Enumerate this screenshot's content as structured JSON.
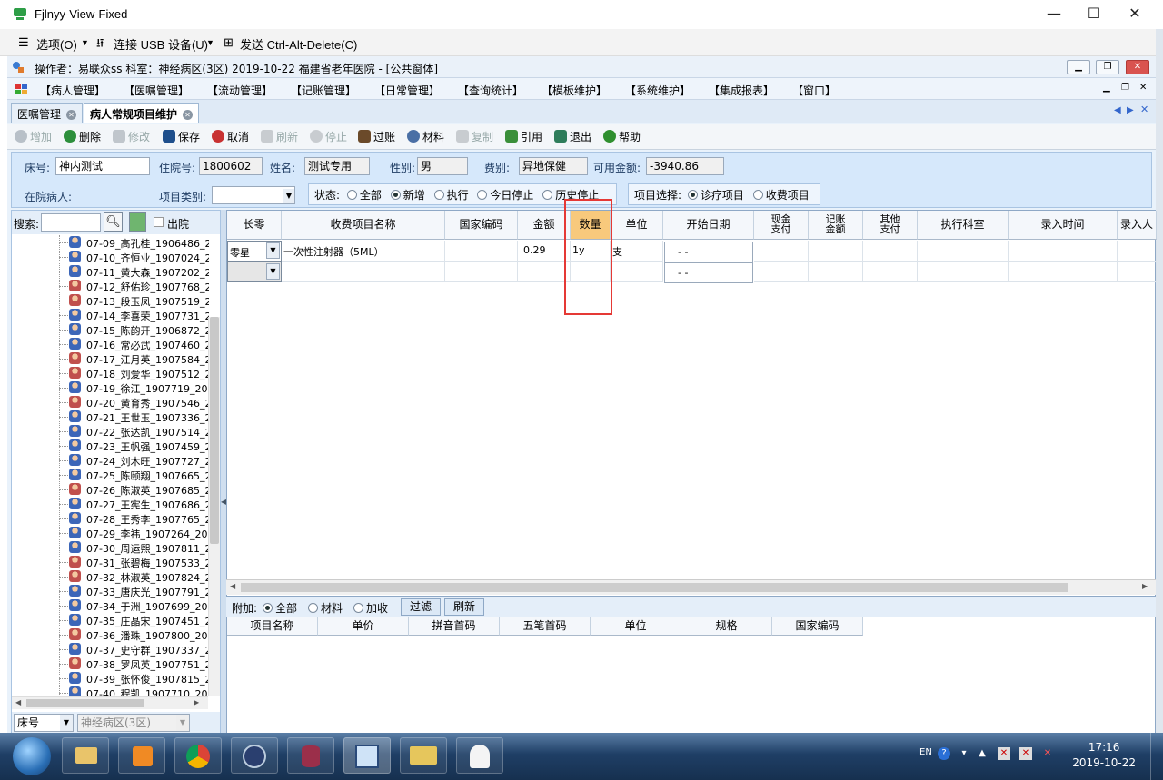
{
  "window": {
    "title": "Fjlnyy-View-Fixed",
    "minimize": "—",
    "maximize": "☐",
    "close": "✕"
  },
  "vm_toolbar": {
    "options": "选项(O)",
    "usb": "连接 USB 设备(U)",
    "send": "发送 Ctrl-Alt-Delete(C)"
  },
  "app": {
    "title": "操作者：易联众ss   科室：神经病区(3区)   2019-10-22   福建省老年医院 - [公共窗体]",
    "menu": [
      "【病人管理】",
      "【医嘱管理】",
      "【流动管理】",
      "【记账管理】",
      "【日常管理】",
      "【查询统计】",
      "【模板维护】",
      "【系统维护】",
      "【集成报表】",
      "【窗口】"
    ],
    "tabs": [
      "医嘱管理",
      "病人常规项目维护"
    ],
    "toolbar": {
      "add": "增加",
      "delete": "删除",
      "modify": "修改",
      "save": "保存",
      "cancel": "取消",
      "refresh": "刷新",
      "stop": "停止",
      "post": "过账",
      "material": "材料",
      "copy": "复制",
      "quote": "引用",
      "exit": "退出",
      "help": "帮助"
    }
  },
  "form": {
    "bed_label": "床号:",
    "bed_value": "神内测试",
    "admission_label": "住院号:",
    "admission_value": "1800602",
    "name_label": "姓名:",
    "name_value": "测试专用",
    "gender_label": "性别:",
    "gender_value": "男",
    "fee_type_label": "费别:",
    "fee_type_value": "异地保健",
    "balance_label": "可用金额:",
    "balance_value": "-3940.86",
    "inpatient_label": "在院病人:",
    "category_label": "项目类别:",
    "category_value": "",
    "status_label": "状态:",
    "status_options": [
      "全部",
      "新增",
      "执行",
      "今日停止",
      "历史停止"
    ],
    "status_selected": "新增",
    "selection_label": "项目选择:",
    "selection_options": [
      "诊疗项目",
      "收费项目"
    ],
    "selection_selected": "诊疗项目"
  },
  "left": {
    "search_label": "搜索:",
    "discharged_label": "出院",
    "patients": [
      "07-09_高孔桂_1906486_2",
      "07-10_齐恒业_1907024_2",
      "07-11_黄大森_1907202_2",
      "07-12_舒佑珍_1907768_2",
      "07-13_段玉凤_1907519_2",
      "07-14_李喜荣_1907731_2",
      "07-15_陈韵开_1906872_2",
      "07-16_常必武_1907460_2",
      "07-17_江月英_1907584_2",
      "07-18_刘爱华_1907512_2",
      "07-19_徐江_1907719_201",
      "07-20_黄育秀_1907546_2",
      "07-21_王世玉_1907336_2",
      "07-22_张达凯_1907514_2",
      "07-23_王帆强_1907459_2",
      "07-24_刘木旺_1907727_2",
      "07-25_陈颐翔_1907665_2",
      "07-26_陈淑英_1907685_2",
      "07-27_王宪生_1907686_2",
      "07-28_王秀李_1907765_2",
      "07-29_李祎_1907264_201",
      "07-30_周运熙_1907811_2",
      "07-31_张碧梅_1907533_2",
      "07-32_林淑英_1907824_2",
      "07-33_唐庆光_1907791_2",
      "07-34_于洲_1907699_201",
      "07-35_庄晶宋_1907451_2",
      "07-36_潘珠_1907800_201",
      "07-37_史守群_1907337_2",
      "07-38_罗凤英_1907751_2",
      "07-39_张怀俊_1907815_2",
      "07-40_程凯_1907710_201"
    ],
    "patient_gender": [
      "m",
      "m",
      "m",
      "f",
      "f",
      "m",
      "m",
      "m",
      "f",
      "f",
      "m",
      "f",
      "m",
      "m",
      "m",
      "m",
      "m",
      "f",
      "m",
      "m",
      "m",
      "m",
      "f",
      "f",
      "m",
      "m",
      "m",
      "f",
      "m",
      "f",
      "m",
      "m"
    ],
    "bed_label": "床号",
    "ward_value": "神经病区(3区)"
  },
  "grid": {
    "headers": [
      "长零",
      "收费项目名称",
      "国家编码",
      "金额",
      "数量",
      "单位",
      "开始日期",
      "现金\n支付",
      "记账\n金额",
      "其他\n支付",
      "执行科室",
      "录入时间",
      "录入人"
    ],
    "rows": [
      {
        "type": "零星",
        "name": "一次性注射器（5ML）",
        "code": "",
        "amount": "0.29",
        "qty": "1y",
        "unit": "支",
        "start": "-   -"
      },
      {
        "type": "",
        "name": "",
        "code": "",
        "amount": "",
        "qty": "",
        "unit": "",
        "start": "-   -"
      }
    ]
  },
  "addon": {
    "label": "附加:",
    "options": [
      "全部",
      "材料",
      "加收"
    ],
    "selected": "全部",
    "filter": "过滤",
    "refresh": "刷新",
    "headers": [
      "项目名称",
      "单价",
      "拼音首码",
      "五笔首码",
      "单位",
      "规格",
      "国家编码"
    ]
  },
  "taskbar": {
    "lang": "EN",
    "time": "17:16",
    "date": "2019-10-22"
  }
}
